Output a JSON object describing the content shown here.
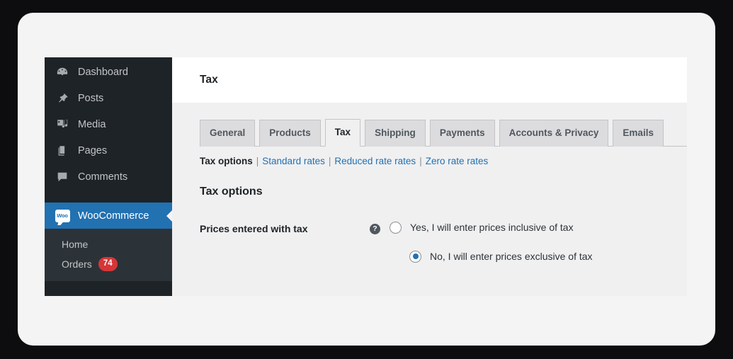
{
  "sidebar": {
    "items": [
      {
        "label": "Dashboard",
        "icon": "dashboard-icon"
      },
      {
        "label": "Posts",
        "icon": "pin-icon"
      },
      {
        "label": "Media",
        "icon": "media-icon"
      },
      {
        "label": "Pages",
        "icon": "pages-icon"
      },
      {
        "label": "Comments",
        "icon": "comments-icon"
      }
    ],
    "woocommerce": {
      "label": "WooCommerce",
      "icon_text": "Woo",
      "active_color": "#2271b1"
    },
    "submenu": [
      {
        "label": "Home",
        "badge": null
      },
      {
        "label": "Orders",
        "badge": "74"
      }
    ],
    "badge_color": "#d63638",
    "background": "#1d2327",
    "submenu_background": "#2c3338"
  },
  "header": {
    "title": "Tax"
  },
  "tabs": [
    {
      "label": "General",
      "active": false
    },
    {
      "label": "Products",
      "active": false
    },
    {
      "label": "Tax",
      "active": true
    },
    {
      "label": "Shipping",
      "active": false
    },
    {
      "label": "Payments",
      "active": false
    },
    {
      "label": "Accounts & Privacy",
      "active": false
    },
    {
      "label": "Emails",
      "active": false
    }
  ],
  "subtabs": {
    "current": "Tax options",
    "links": [
      "Standard rates",
      "Reduced rate rates",
      "Zero rate rates"
    ],
    "separator": "|",
    "link_color": "#2271b1"
  },
  "section": {
    "title": "Tax options",
    "field_label": "Prices entered with tax",
    "help_icon": "?",
    "options": [
      {
        "label": "Yes, I will enter prices inclusive of tax",
        "selected": false
      },
      {
        "label": "No, I will enter prices exclusive of tax",
        "selected": true
      }
    ]
  }
}
